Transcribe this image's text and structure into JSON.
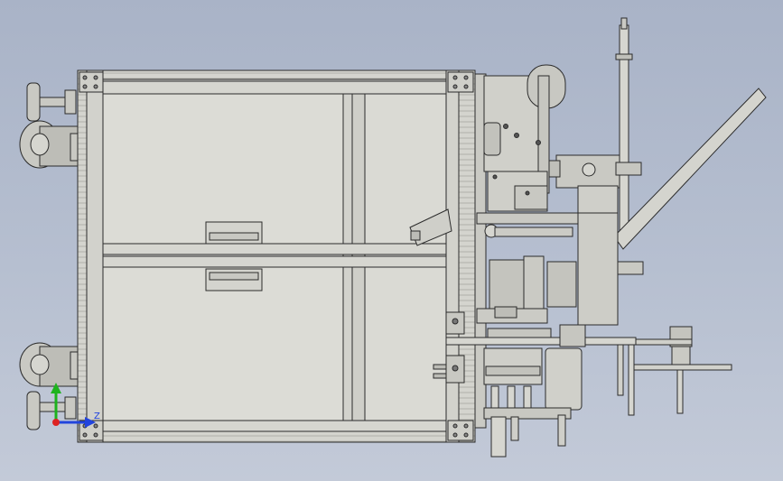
{
  "view": {
    "background_top": "#a9b3c7",
    "background_bottom": "#c3cad8",
    "part_fill": "#d9d9d3",
    "part_fill_dark": "#c4c4bd",
    "edge_color": "#2b2b2b"
  },
  "triad": {
    "axis_y_color": "#1db31d",
    "axis_z_color": "#2244dd",
    "origin_color": "#dd2222",
    "z_label": "Z"
  }
}
